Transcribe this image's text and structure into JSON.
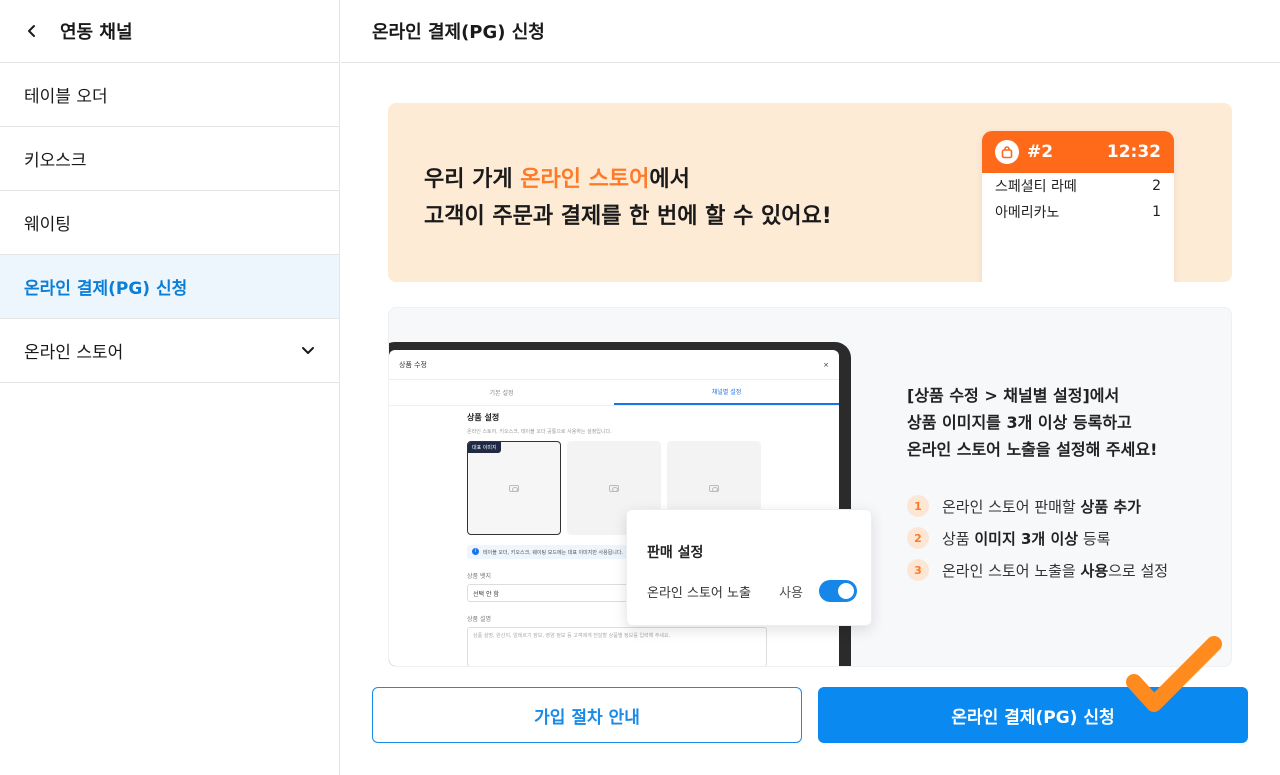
{
  "sidebar": {
    "title": "연동 채널",
    "items": [
      {
        "label": "테이블 오더"
      },
      {
        "label": "키오스크"
      },
      {
        "label": "웨이팅"
      },
      {
        "label": "온라인 결제(PG) 신청"
      },
      {
        "label": "온라인 스토어"
      }
    ]
  },
  "main": {
    "title": "온라인 결제(PG) 신청",
    "banner": {
      "line1_pre": "우리 가게 ",
      "line1_highlight": "온라인 스토어",
      "line1_post": "에서",
      "line2": "고객이 주문과 결제를 한 번에 할 수 있어요!",
      "receipt": {
        "order_no": "#2",
        "time": "12:32",
        "rows": [
          {
            "name": "스페셜티 라떼",
            "qty": "2"
          },
          {
            "name": "아메리카노",
            "qty": "1"
          }
        ]
      }
    },
    "guide": {
      "screen": {
        "title": "상품 수정",
        "close": "×",
        "tab1": "기본 설정",
        "tab2": "채널별 설정",
        "section_title": "상품 설정",
        "section_sub": "온라인 스토어, 키오스크, 테이블 오더 공통으로 사용하는 설정입니다.",
        "main_img_tag": "대표 이미지",
        "info_text": "테이블 오더, 키오스크, 웨이팅 모드에는 대표 이미지만 사용됩니다.",
        "field1_label": "상품 뱃지",
        "field1_value": "선택 안 함",
        "field2_label": "상품 설명",
        "field2_placeholder": "상품 설명, 원산지, 알레르기 정보, 영양 정보 등 고객에게 전달할 상품별 정보를 입력해 주세요."
      },
      "popup": {
        "title": "판매 설정",
        "row_label": "온라인 스토어 노출",
        "toggle_label": "사용"
      },
      "text_line1": "[상품 수정 > 채널별 설정]에서",
      "text_line2": "상품 이미지를 3개 이상 등록하고",
      "text_line3": "온라인 스토어 노출을 설정해 주세요!",
      "steps": [
        {
          "num": "1",
          "pre": "온라인 스토어 판매할 ",
          "bold": "상품 추가",
          "post": ""
        },
        {
          "num": "2",
          "pre": "상품 ",
          "bold": "이미지 3개 이상",
          "post": " 등록"
        },
        {
          "num": "3",
          "pre": "온라인 스토어 노출을 ",
          "bold": "사용",
          "post": "으로 설정"
        }
      ]
    },
    "buttons": {
      "guide_label": "가입 절차 안내",
      "apply_label": "온라인 결제(PG) 신청"
    }
  },
  "colors": {
    "accent_blue": "#0a8af0",
    "accent_orange": "#ff7a27",
    "banner_bg": "#feebd6"
  }
}
